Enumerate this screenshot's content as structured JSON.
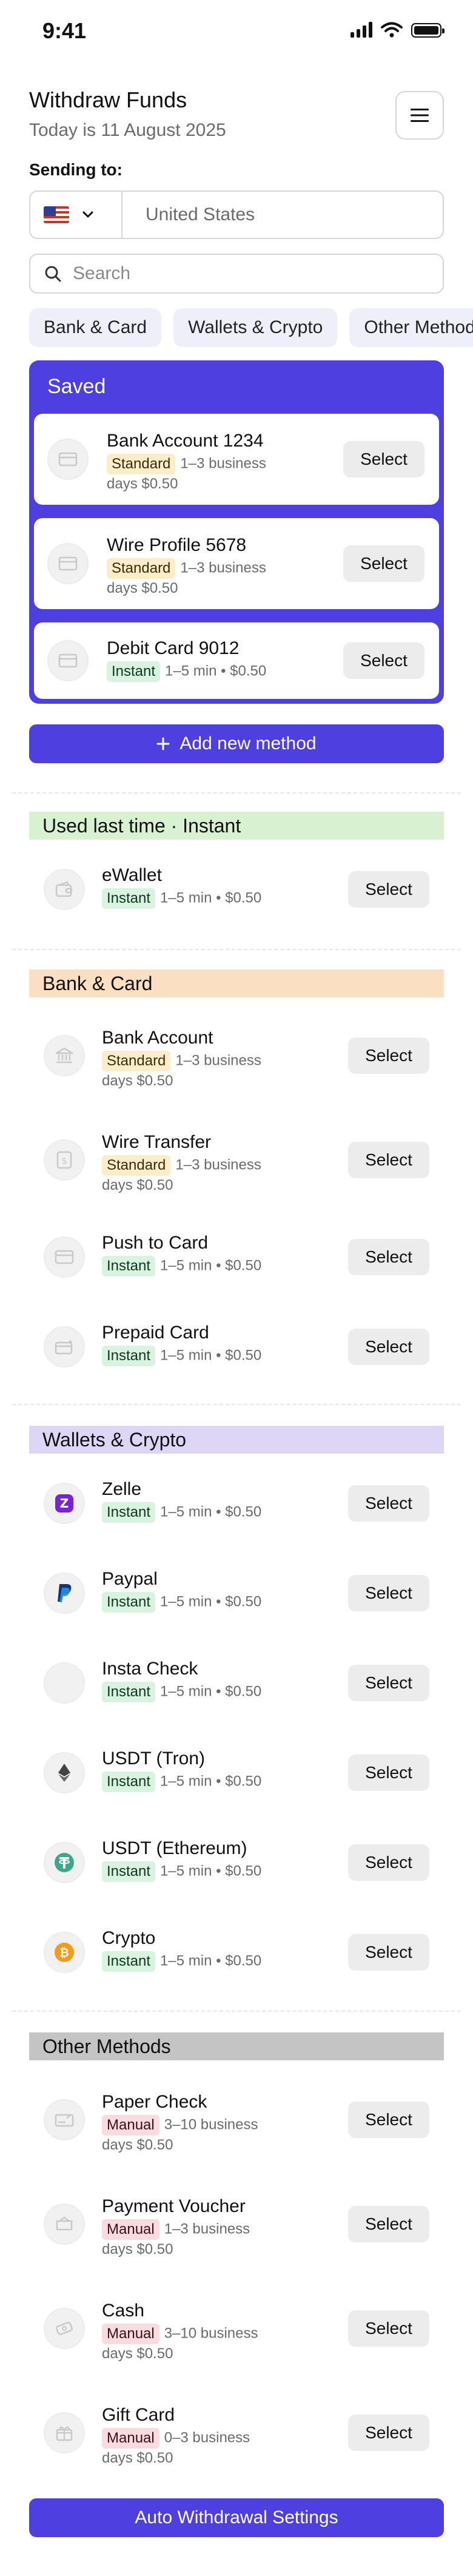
{
  "status": {
    "time": "9:41"
  },
  "header": {
    "title": "Withdraw Funds",
    "date": "Today is 11 August 2025"
  },
  "sending": {
    "label": "Sending to:",
    "country": "United States"
  },
  "search": {
    "placeholder": "Search"
  },
  "chips": [
    "Bank & Card",
    "Wallets & Crypto",
    "Other Methods"
  ],
  "saved": {
    "title": "Saved",
    "items": [
      {
        "name": "Bank Account 1234",
        "badge": "Standard",
        "meta": "1–3 business days $0.50",
        "select": "Select"
      },
      {
        "name": "Wire Profile 5678",
        "badge": "Standard",
        "meta": "1–3 business days $0.50",
        "select": "Select"
      },
      {
        "name": "Debit Card 9012",
        "badge": "Instant",
        "meta": "1–5 min • $0.50",
        "select": "Select"
      }
    ]
  },
  "add_method": {
    "label": "Add new method",
    "icon": "plus-icon"
  },
  "sections": [
    {
      "title": "Used last time · Instant",
      "color": "#d8f1d0",
      "items": [
        {
          "name": "eWallet",
          "badge": "Instant",
          "meta": "1–5 min • $0.50",
          "select": "Select",
          "icon": "wallet-icon"
        }
      ]
    },
    {
      "title": "Bank & Card",
      "color": "#fbdfc3",
      "items": [
        {
          "name": "Bank Account",
          "badge": "Standard",
          "meta": "1–3 business days $0.50",
          "select": "Select",
          "icon": "bank-icon"
        },
        {
          "name": "Wire Transfer",
          "badge": "Standard",
          "meta": "1–3 business days $0.50",
          "select": "Select",
          "icon": "wire-icon"
        },
        {
          "name": "Push to Card",
          "badge": "Instant",
          "meta": "1–5 min • $0.50",
          "select": "Select",
          "icon": "card-icon"
        },
        {
          "name": "Prepaid Card",
          "badge": "Instant",
          "meta": "1–5 min • $0.50",
          "select": "Select",
          "icon": "prepaid-card-icon"
        }
      ]
    },
    {
      "title": "Wallets & Crypto",
      "color": "#ddd6f5",
      "items": [
        {
          "name": "Zelle",
          "badge": "Instant",
          "meta": "1–5 min • $0.50",
          "select": "Select",
          "icon": "zelle-icon"
        },
        {
          "name": "Paypal",
          "badge": "Instant",
          "meta": "1–5 min • $0.50",
          "select": "Select",
          "icon": "paypal-icon"
        },
        {
          "name": "Insta Check",
          "badge": "Instant",
          "meta": "1–5 min • $0.50",
          "select": "Select",
          "icon": "insta-check-icon"
        },
        {
          "name": "USDT (Tron)",
          "badge": "Instant",
          "meta": "1–5 min • $0.50",
          "select": "Select",
          "icon": "tron-icon"
        },
        {
          "name": "USDT (Ethereum)",
          "badge": "Instant",
          "meta": "1–5 min • $0.50",
          "select": "Select",
          "icon": "tether-icon"
        },
        {
          "name": "Crypto",
          "badge": "Instant",
          "meta": "1–5 min • $0.50",
          "select": "Select",
          "icon": "bitcoin-icon"
        }
      ]
    },
    {
      "title": "Other Methods",
      "color": "#c4c4c4",
      "items": [
        {
          "name": "Paper Check",
          "badge": "Manual",
          "meta": "3–10 business days $0.50",
          "select": "Select",
          "icon": "check-icon"
        },
        {
          "name": "Payment Voucher",
          "badge": "Manual",
          "meta": "1–3 business days $0.50",
          "select": "Select",
          "icon": "voucher-icon"
        },
        {
          "name": "Cash",
          "badge": "Manual",
          "meta": "3–10 business days $0.50",
          "select": "Select",
          "icon": "cash-icon"
        },
        {
          "name": "Gift Card",
          "badge": "Manual",
          "meta": "0–3 business days $0.50",
          "select": "Select",
          "icon": "gift-card-icon"
        }
      ]
    }
  ],
  "auto_withdrawal": {
    "label": "Auto Withdrawal Settings"
  }
}
